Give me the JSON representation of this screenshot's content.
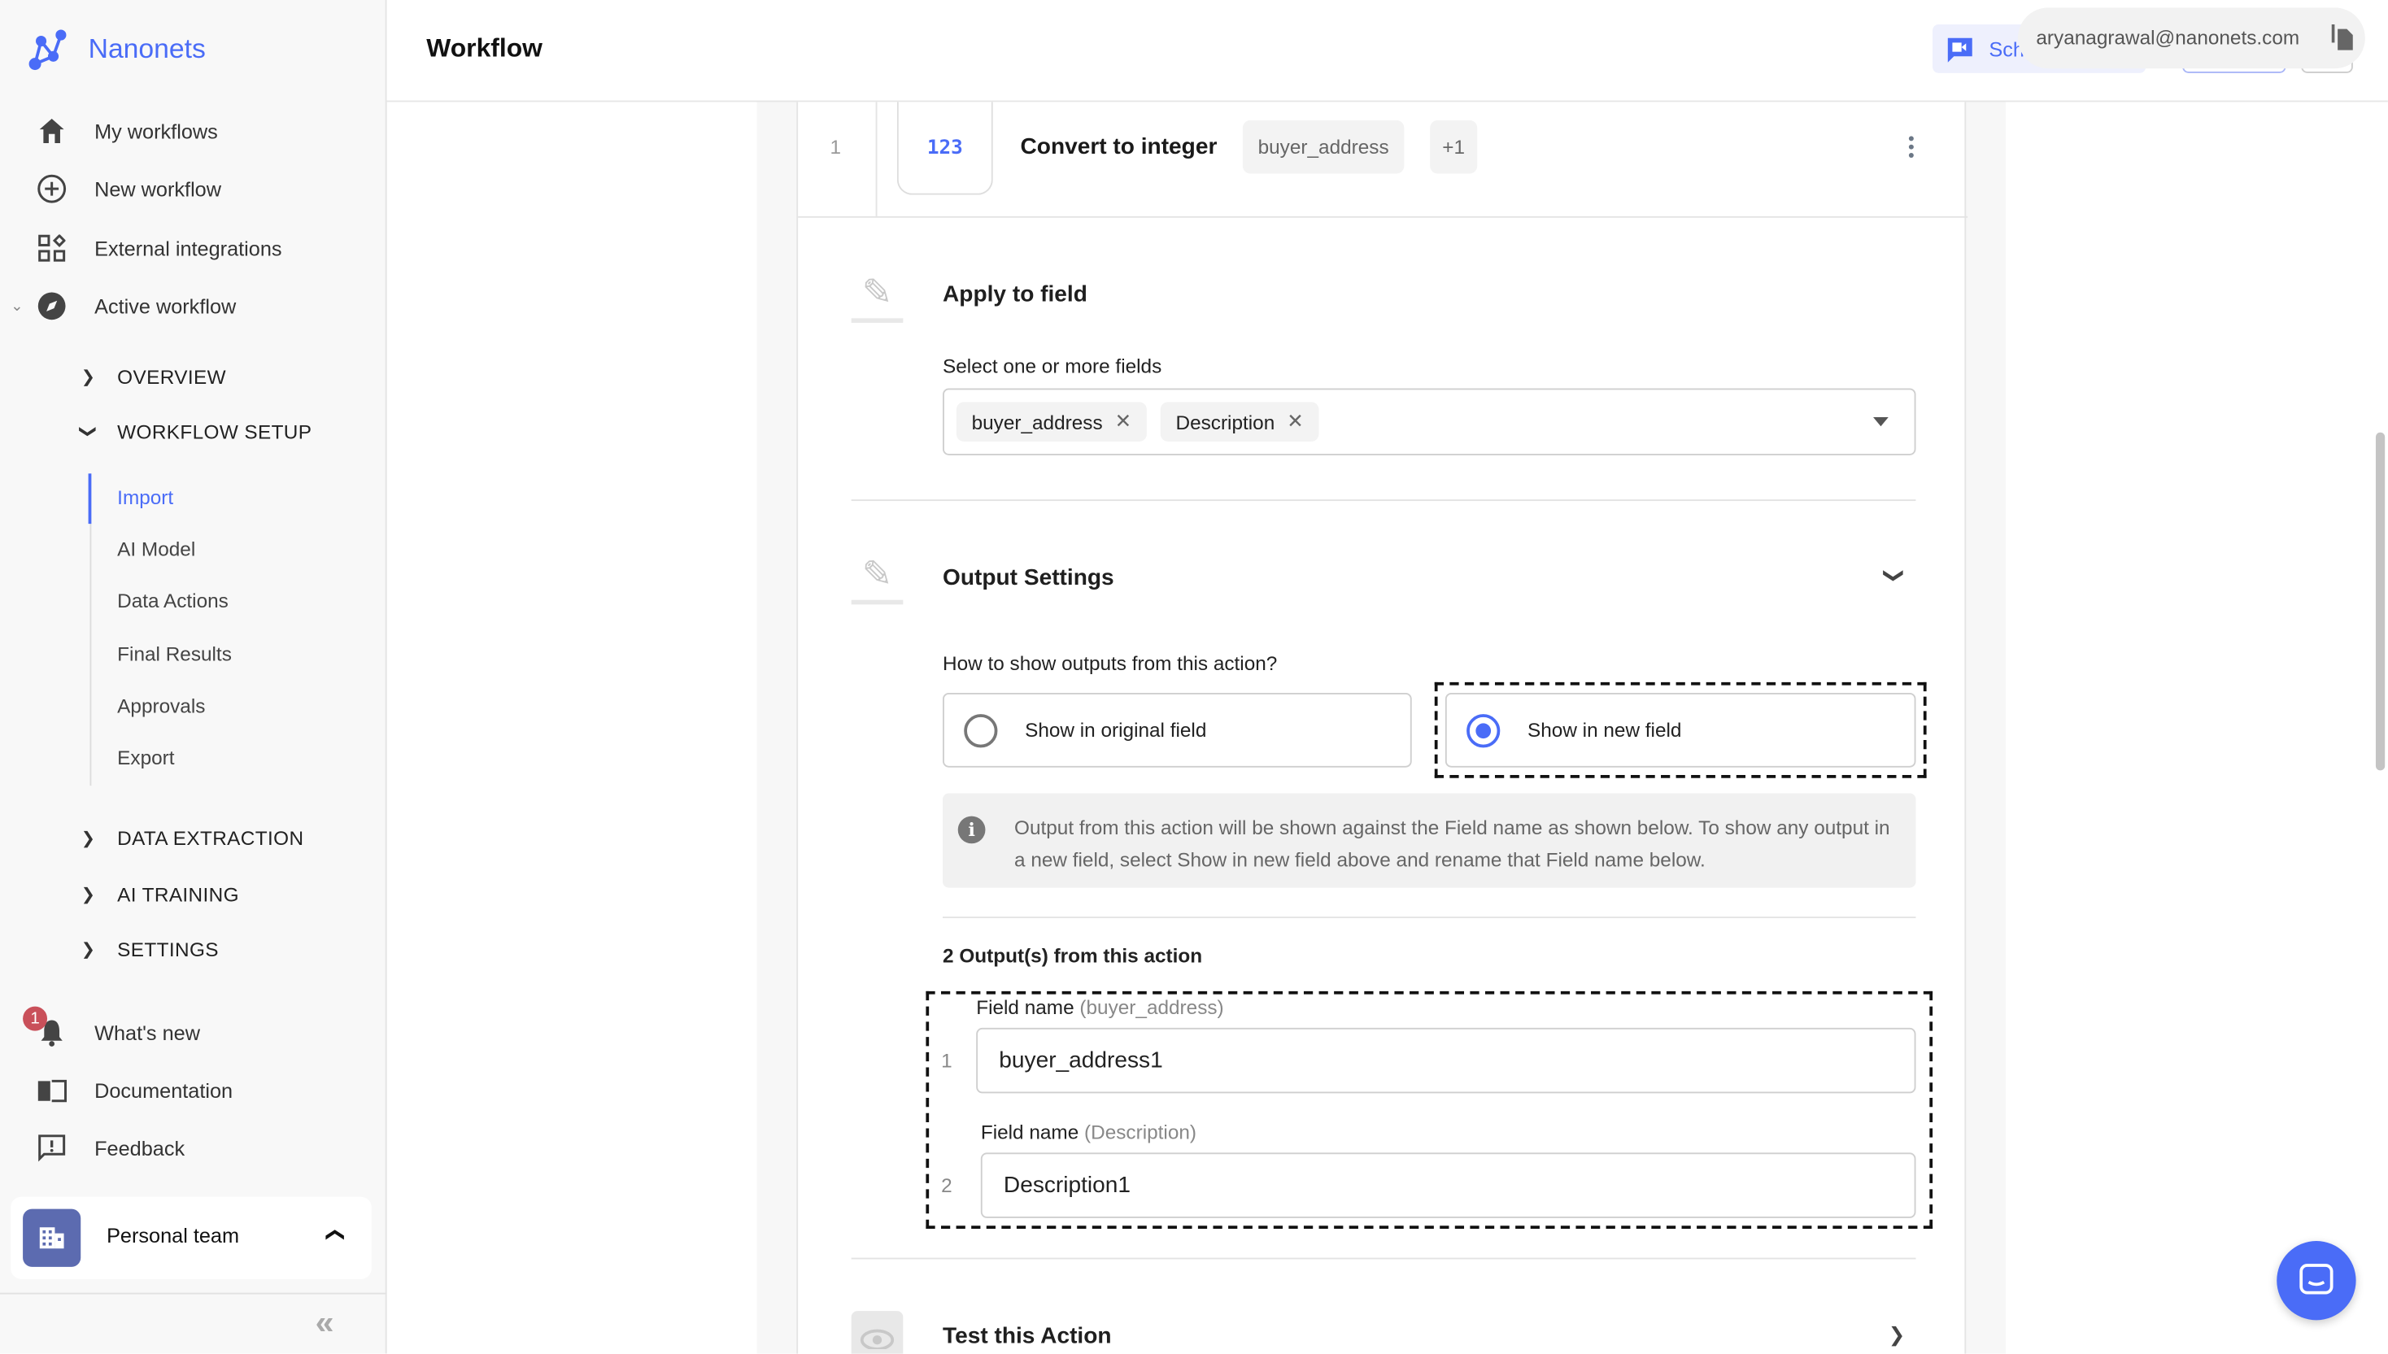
{
  "brand": {
    "name": "Nanonets",
    "color": "#4a6cf7"
  },
  "sidebar": {
    "top_items": [
      {
        "label": "My workflows",
        "icon": "home-icon"
      },
      {
        "label": "New workflow",
        "icon": "plus-circle-icon"
      },
      {
        "label": "External integrations",
        "icon": "integrations-icon"
      },
      {
        "label": "Active workflow",
        "icon": "compass-icon"
      }
    ],
    "sections": [
      {
        "label": "OVERVIEW",
        "expanded": false
      },
      {
        "label": "WORKFLOW SETUP",
        "expanded": true
      },
      {
        "label": "DATA EXTRACTION",
        "expanded": false
      },
      {
        "label": "AI TRAINING",
        "expanded": false
      },
      {
        "label": "SETTINGS",
        "expanded": false
      }
    ],
    "setup_items": [
      "Import",
      "AI Model",
      "Data Actions",
      "Final Results",
      "Approvals",
      "Export"
    ],
    "active_setup_item": "Import",
    "bottom_items": [
      {
        "label": "What's new",
        "icon": "bell-icon",
        "badge": "1"
      },
      {
        "label": "Documentation",
        "icon": "book-icon"
      },
      {
        "label": "Feedback",
        "icon": "feedback-icon"
      }
    ],
    "team": {
      "label": "Personal team"
    }
  },
  "header": {
    "title": "Workflow",
    "schedule_button": "Sch",
    "email_tooltip": "aryanagrawal@nanonets.com"
  },
  "action": {
    "index": "1",
    "icon_text": "123",
    "title": "Convert to integer",
    "field_chip": "buyer_address",
    "more_chip": "+1"
  },
  "apply": {
    "title": "Apply to field",
    "label": "Select one or more fields",
    "selected": [
      "buyer_address",
      "Description"
    ]
  },
  "output": {
    "title": "Output Settings",
    "question": "How to show outputs from this action?",
    "options": [
      {
        "label": "Show in original field",
        "selected": false
      },
      {
        "label": "Show in new field",
        "selected": true
      }
    ],
    "info": "Output from this action will be shown against the Field name as shown below. To show any output in a new field, select Show in new field above and rename that Field name below.",
    "count_label": "2 Output(s) from this action",
    "fields": [
      {
        "index": "1",
        "label": "Field name",
        "source": "(buyer_address)",
        "value": "buyer_address1"
      },
      {
        "index": "2",
        "label": "Field name",
        "source": "(Description)",
        "value": "Description1"
      }
    ]
  },
  "test": {
    "title": "Test this Action"
  }
}
